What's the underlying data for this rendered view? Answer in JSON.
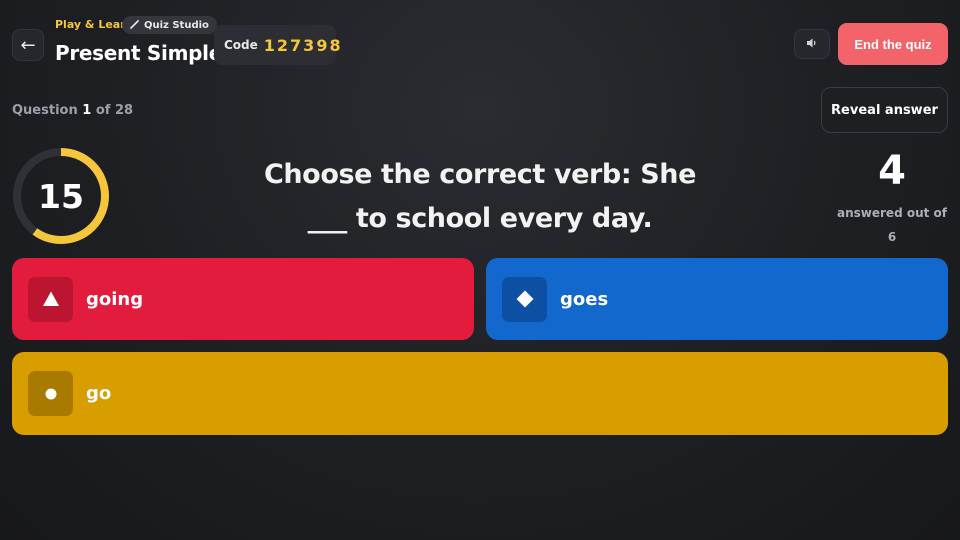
{
  "header": {
    "back_icon": "arrow-left-icon",
    "brand": "Play & Learn",
    "studio_label": "Quiz Studio",
    "studio_icon": "wand-icon",
    "title": "Present Simple",
    "code_label": "Code",
    "code_value": "127398",
    "sound_icon": "speaker-icon",
    "end_label": "End the quiz"
  },
  "question": {
    "counter_prefix": "Question",
    "current": "1",
    "of_total": "of 28",
    "reveal_label": "Reveal answer",
    "timer": "15",
    "timer_fraction": 0.6,
    "text_line1": "Choose the correct verb: She",
    "text_line2": "___ to school every day.",
    "answered_count": "4",
    "answered_label": "answered out of",
    "answered_total": "6"
  },
  "answers": [
    {
      "label": "going",
      "shape": "triangle-icon",
      "color": "#e31c3d"
    },
    {
      "label": "goes",
      "shape": "diamond-icon",
      "color": "#1368ce"
    },
    {
      "label": "go",
      "shape": "circle-icon",
      "color": "#d89e00"
    }
  ],
  "colors": {
    "accent": "#f5c63c",
    "end_button": "#f2646a",
    "timer_ring": "#f5c63c"
  }
}
